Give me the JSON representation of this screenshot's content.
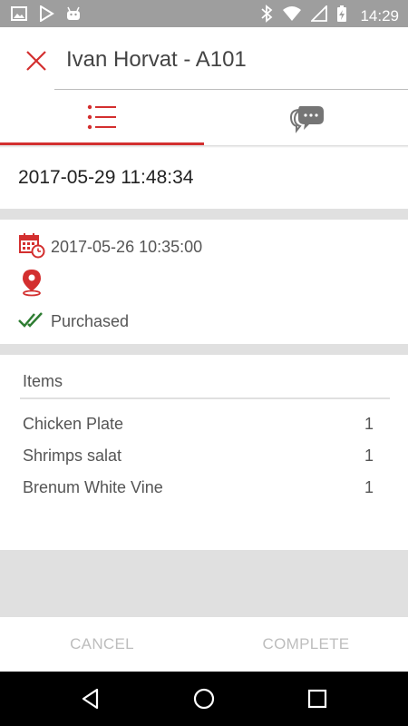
{
  "status_bar": {
    "time": "14:29",
    "icons": [
      "image-icon",
      "play-store-icon",
      "android-icon",
      "bluetooth-icon",
      "wifi-icon",
      "signal-icon",
      "battery-charging-icon"
    ]
  },
  "header": {
    "title": "Ivan Horvat - A101",
    "close_icon": "close-icon"
  },
  "tabs": [
    {
      "name": "details",
      "icon": "list-icon",
      "active": true
    },
    {
      "name": "chat",
      "icon": "chat-bubbles-icon",
      "active": false
    }
  ],
  "order": {
    "created": "2017-05-29 11:48:34",
    "scheduled": "2017-05-26 10:35:00",
    "location": "",
    "status": "Purchased"
  },
  "items": {
    "title": "Items",
    "rows": [
      {
        "name": "Chicken Plate",
        "qty": "1"
      },
      {
        "name": "Shrimps salat",
        "qty": "1"
      },
      {
        "name": "Brenum White Vine",
        "qty": "1"
      }
    ]
  },
  "actions": {
    "cancel_label": "CANCEL",
    "complete_label": "COMPLETE"
  },
  "colors": {
    "accent": "#d32f2f",
    "success": "#2e7d32",
    "status_bar": "#9e9e9e",
    "disabled_text": "#bdbdbd"
  }
}
